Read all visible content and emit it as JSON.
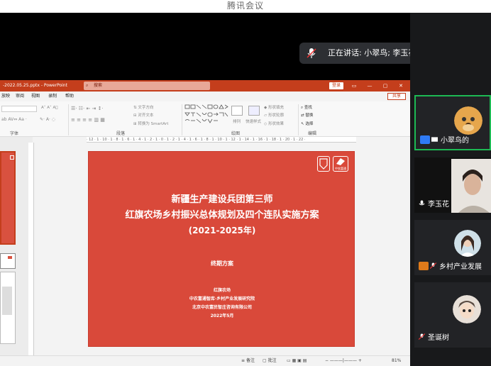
{
  "window": {
    "title": "腾讯会议"
  },
  "speaking": {
    "label": "正在讲话: 小翠鸟; 李玉花;"
  },
  "ppt": {
    "filename": "-2022.05.25.pptx - PowerPoint",
    "search_placeholder": "搜索",
    "signin": "登录",
    "share": "共享",
    "menu": [
      "放映",
      "审阅",
      "视图",
      "录制",
      "帮助"
    ],
    "ribbon": {
      "font_group": "字体",
      "paragraph_group": "段落",
      "drawing_group": "绘图",
      "editing_group": "编辑",
      "find": "查找",
      "replace": "替换",
      "select": "选择",
      "text_direction": "文字方向",
      "align_text": "对齐文本",
      "smartart": "转换为 SmartArt",
      "arrange": "排列",
      "quick_styles": "快速样式",
      "shape_fill": "形状填充",
      "shape_outline": "形状轮廓",
      "shape_effects": "形状效果"
    },
    "ruler": "· 12 · 1 · 10 · 1 · 8 · 1 · 6 · 1 · 4 · 1 · 2 · 1 · 0 · 1 · 2 · 1 · 4 · 1 · 6 · 1 · 8 · 1 · 10 · 1 · 12 · 1 · 14 · 1 · 16 · 1 · 18 · 1 · 20 · 1 · 22 ·",
    "slide": {
      "title_line1": "新疆生产建设兵团第三师",
      "title_line2": "红旗农场乡村振兴总体规划及四个连队实施方案",
      "years": "(2021-2025年)",
      "subtitle": "终期方案",
      "org1": "红旗农场",
      "org2": "中农富通智库·乡村产业发展研究院",
      "org3": "北京中农富民智庄咨询有限公司",
      "date": "2022年5月",
      "logo_text": "中农富通"
    },
    "status": {
      "notes": "备注",
      "comments": "批注",
      "zoom": "81%"
    }
  },
  "participants": [
    {
      "name": "小翠鸟的",
      "avatar": "dog-avatar",
      "active": true
    },
    {
      "name": "李玉花",
      "avatar": "camera-video"
    },
    {
      "name": "乡村产业发展",
      "avatar": "girl-avatar"
    },
    {
      "name": "圣诞树",
      "avatar": "cartoon-avatar"
    }
  ],
  "colors": {
    "ppt_red": "#c43e1c",
    "slide_red": "#d9493a",
    "active_border": "#1db954"
  }
}
